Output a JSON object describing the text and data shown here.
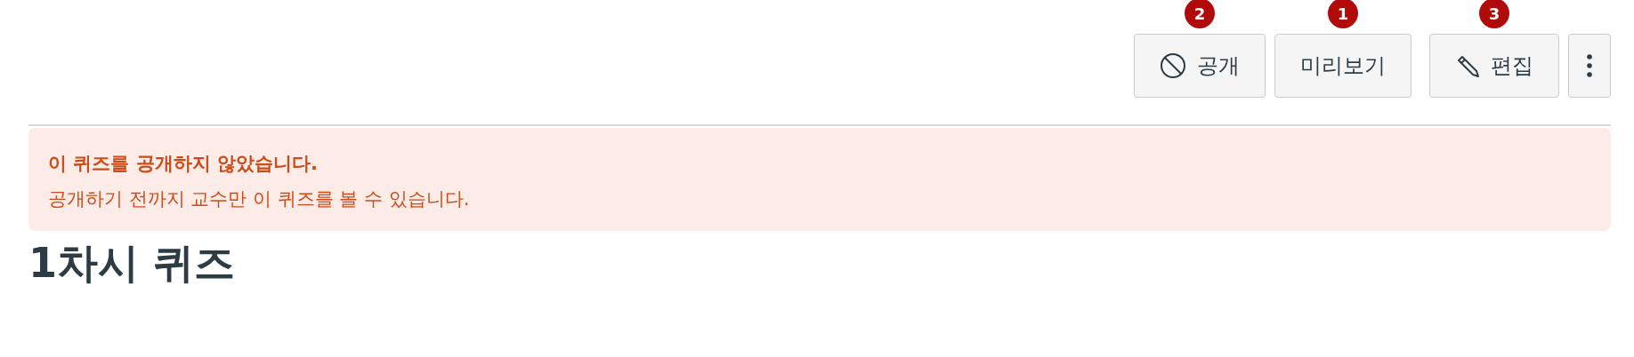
{
  "toolbar": {
    "buttons": [
      {
        "kind": "publish",
        "label": "공개",
        "badge": "2"
      },
      {
        "kind": "plain",
        "label": "미리보기",
        "badge": "1"
      },
      {
        "kind": "edit",
        "label": "편집",
        "badge": "3"
      },
      {
        "kind": "more"
      }
    ]
  },
  "alert": {
    "title": "이 퀴즈를 공개하지 않았습니다.",
    "message": "공개하기 전까지 교수만 이 퀴즈를 볼 수 있습니다."
  },
  "heading": "1차시 퀴즈"
}
